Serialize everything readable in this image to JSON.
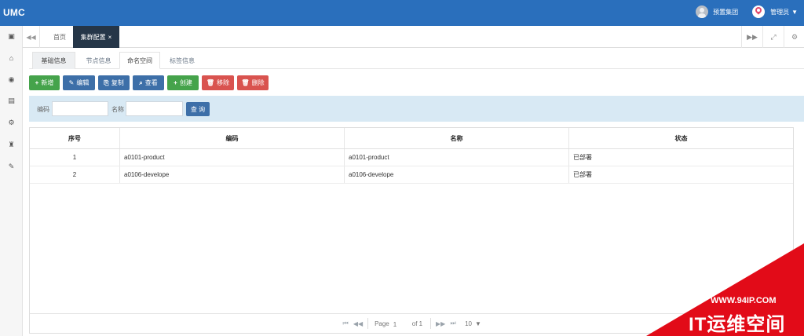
{
  "app": {
    "title": "UMC"
  },
  "topbar": {
    "group_label": "预置集团",
    "admin_label": "管理员",
    "icons": [
      "user-avatar-icon",
      "location-pin-icon",
      "caret-down-icon"
    ]
  },
  "sidebar": {
    "items": [
      {
        "name": "id-card-icon",
        "glyph": "▣"
      },
      {
        "name": "bank-icon",
        "glyph": "⌂"
      },
      {
        "name": "eye-icon",
        "glyph": "◉"
      },
      {
        "name": "table-icon",
        "glyph": "▤"
      },
      {
        "name": "gear-icon",
        "glyph": "⚙"
      },
      {
        "name": "sitemap-icon",
        "glyph": "♜"
      },
      {
        "name": "wrench-icon",
        "glyph": "✎"
      }
    ]
  },
  "tabs": {
    "home": "首页",
    "active": "集群配置",
    "close_glyph": "×",
    "nav_left_glyph": "◀◀",
    "nav_right_glyph": "▶▶",
    "fullscreen_glyph": "⤢",
    "settings_glyph": "⚙"
  },
  "subtabs": [
    "基础信息",
    "节点信息",
    "命名空间",
    "标签信息"
  ],
  "toolbar": {
    "buttons": [
      {
        "name": "add-button",
        "label": "新增",
        "glyph": "+",
        "color": "#45a34b"
      },
      {
        "name": "edit-button",
        "label": "编辑",
        "glyph": "✎",
        "color": "#3d6fa8"
      },
      {
        "name": "copy-button",
        "label": "复制",
        "glyph": "⎘",
        "color": "#3d6fa8"
      },
      {
        "name": "view-button",
        "label": "查看",
        "glyph": "⌕",
        "color": "#3d6fa8"
      },
      {
        "name": "create-button",
        "label": "创建",
        "glyph": "+",
        "color": "#45a34b"
      },
      {
        "name": "remove-button",
        "label": "移除",
        "glyph": "🗑",
        "color": "#d9534f"
      },
      {
        "name": "delete-button",
        "label": "删除",
        "glyph": "🗑",
        "color": "#d9534f"
      }
    ]
  },
  "search": {
    "code_label": "编码",
    "name_label": "名称",
    "button_label": "查 询"
  },
  "table": {
    "headers": [
      "序号",
      "编码",
      "名称",
      "状态"
    ],
    "rows": [
      [
        "1",
        "a0101-product",
        "a0101-product",
        "已部署"
      ],
      [
        "2",
        "a0106-develope",
        "a0106-develope",
        "已部署"
      ]
    ]
  },
  "pagination": {
    "page_label": "Page",
    "page_value": "1",
    "total_label": "of 1",
    "page_size": "10",
    "first_glyph": "⏮",
    "prev_glyph": "◀◀",
    "next_glyph": "▶▶",
    "last_glyph": "⏭"
  },
  "watermark": {
    "url": "WWW.94IP.COM",
    "name": "IT运维空间"
  }
}
